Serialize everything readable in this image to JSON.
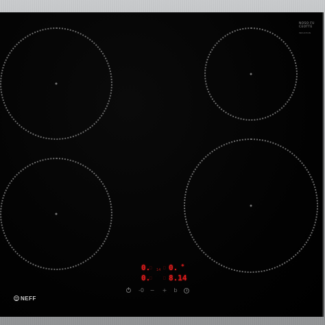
{
  "badge": {
    "line1": "NOSO FU",
    "line2": "CEOTTE",
    "line3": "INDUCTION"
  },
  "display": {
    "left_top": "0.",
    "left_bottom": "0.",
    "right_top": "0.",
    "right_bottom": "8.14",
    "center_mark": "14",
    "right_top_suffix": "*"
  },
  "controls": {
    "power": "power-icon",
    "minus_alt": "-0",
    "minus": "−",
    "plus": "+",
    "boost": "b",
    "timer": "timer-icon"
  },
  "brand": {
    "name": "NEFF",
    "color": "#cfcfcf"
  },
  "colors": {
    "led": "#e11b1b",
    "glass": "#000000",
    "frame": "#a9abad"
  }
}
